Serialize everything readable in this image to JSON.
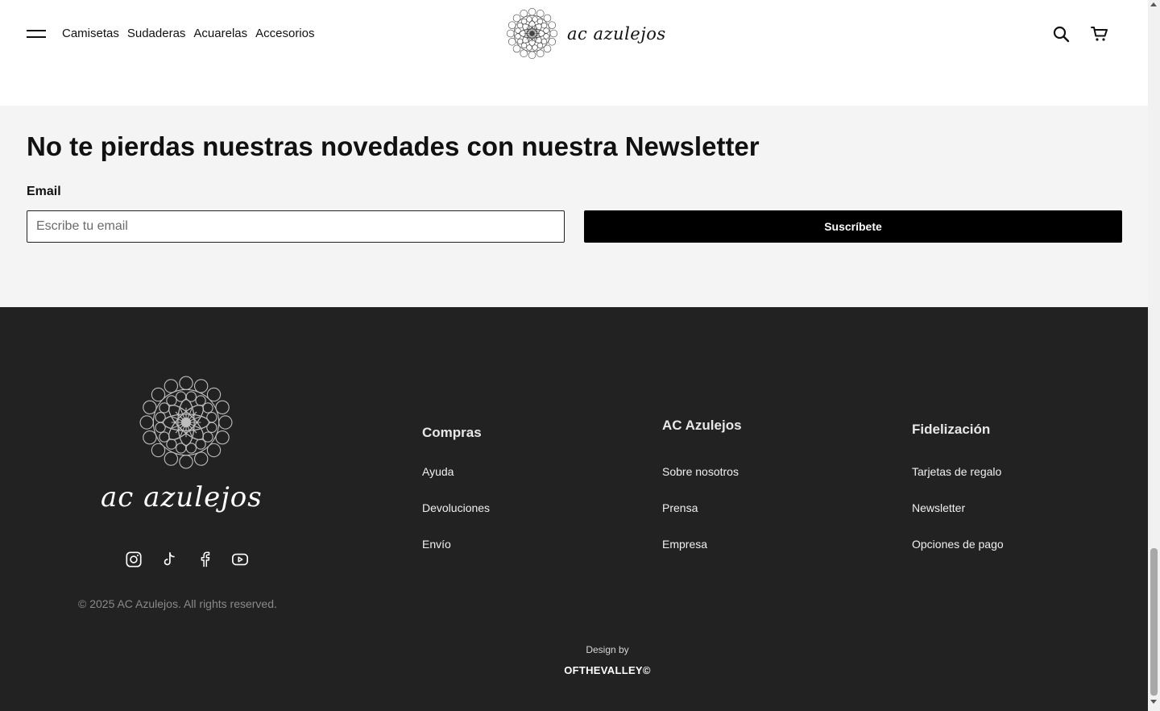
{
  "header": {
    "nav": [
      "Camisetas",
      "Sudaderas",
      "Acuarelas",
      "Accesorios"
    ],
    "logo_text": "ac azulejos",
    "icons": [
      "menu-icon",
      "search-icon",
      "cart-icon"
    ]
  },
  "newsletter": {
    "title": "No te pierdas nuestras novedades con nuestra Newsletter",
    "email_label": "Email",
    "email_placeholder": "Escribe tu email",
    "email_value": "",
    "submit_label": "Suscríbete"
  },
  "footer": {
    "brand": "ac azulejos",
    "socials": [
      "instagram-icon",
      "tiktok-icon",
      "facebook-icon",
      "youtube-icon"
    ],
    "copyright": "© 2025 AC Azulejos. All rights reserved.",
    "columns": [
      {
        "title": "Compras",
        "links": [
          "Ayuda",
          "Devoluciones",
          "Envío"
        ]
      },
      {
        "title": "AC Azulejos",
        "links": [
          "Sobre nosotros",
          "Prensa",
          "Empresa"
        ]
      },
      {
        "title": "Fidelización",
        "links": [
          "Tarjetas de regalo",
          "Newsletter",
          "Opciones de pago"
        ]
      }
    ],
    "design_by": "Design by",
    "designer": "OFTHEVALLEY©"
  },
  "colors": {
    "footer_bg": "#222222",
    "newsletter_bg": "#f4f4f4",
    "button_bg": "#000000"
  }
}
